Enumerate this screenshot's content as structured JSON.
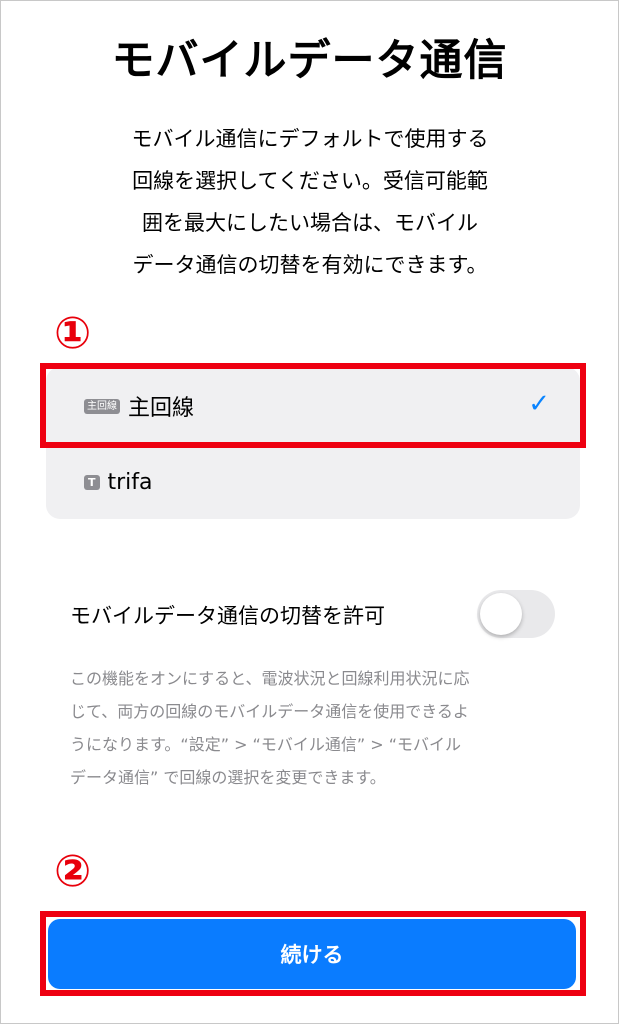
{
  "title": "モバイルデータ通信",
  "description": "モバイル通信にデフォルトで使用する\n回線を選択してください。受信可能範\n囲を最大にしたい場合は、モバイル\nデータ通信の切替を有効にできます。",
  "annotations": {
    "step1": "①",
    "step2": "②",
    "color": "#e8000b"
  },
  "lines": [
    {
      "badge": "主回線",
      "label": "主回線",
      "selected": true,
      "check": "✓"
    },
    {
      "badge": "T",
      "label": "trifa",
      "selected": false
    }
  ],
  "switching": {
    "label": "モバイルデータ通信の切替を許可",
    "enabled": false,
    "note": "この機能をオンにすると、電波状況と回線利用状況に応\nじて、両方の回線のモバイルデータ通信を使用できるよ\nうになります。“設定” > “モバイル通信” > “モバイル\nデータ通信” で回線の選択を変更できます。"
  },
  "continue_button": {
    "label": "続ける",
    "color": "#0a7cff"
  },
  "colors": {
    "highlight": "#ee0011",
    "check": "#0a84ff"
  }
}
